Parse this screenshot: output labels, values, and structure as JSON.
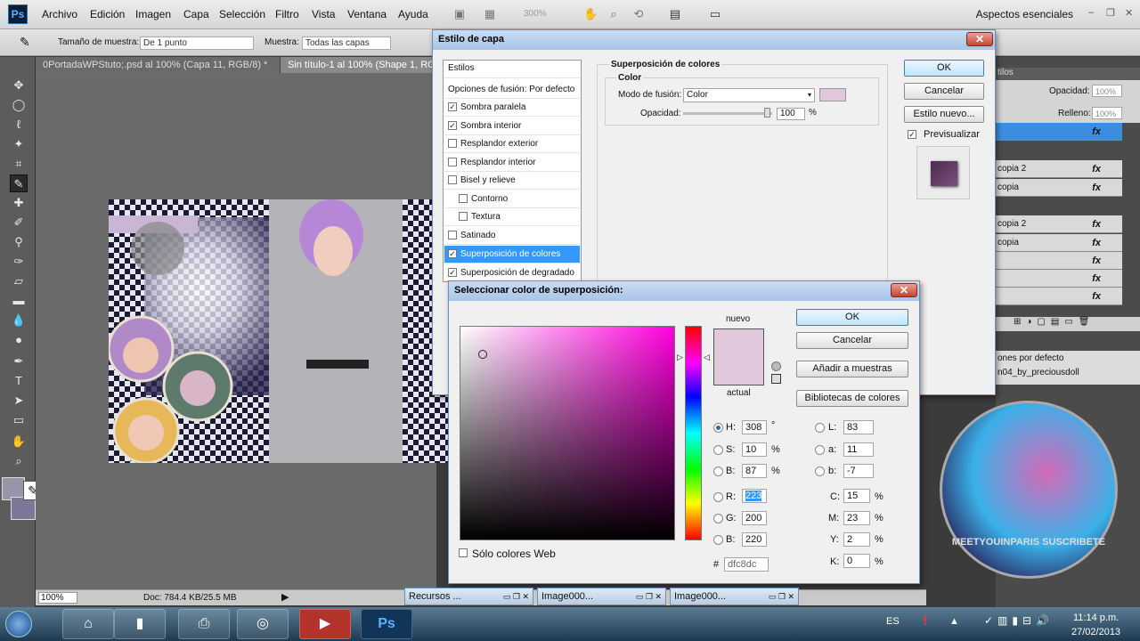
{
  "app": {
    "logo": "Ps",
    "accent": "#3399ff"
  },
  "menubar": {
    "items": [
      "Archivo",
      "Edición",
      "Imagen",
      "Capa",
      "Selección",
      "Filtro",
      "Vista",
      "Ventana",
      "Ayuda"
    ],
    "zoom": "300%",
    "workspace": "Aspectos esenciales",
    "window_controls": [
      "–",
      "❐",
      "✕"
    ]
  },
  "options": {
    "sample_size_label": "Tamaño de muestra:",
    "sample_size_value": "De 1 punto",
    "sample_label": "Muestra:",
    "sample_value": "Todas las capas"
  },
  "tabs": [
    {
      "label": "0PortadaWPStuto;.psd al 100% (Capa 11, RGB/8) *"
    },
    {
      "label": "Sin título-1 al 100% (Shape 1, RGB"
    }
  ],
  "status": {
    "zoom": "100%",
    "doc": "Doc: 784.4 KB/25.5 MB"
  },
  "layer_style": {
    "title": "Estilo de capa",
    "styles_header": "Estilos",
    "blend_options": "Opciones de fusión: Por defecto",
    "items": [
      {
        "label": "Sombra paralela",
        "checked": true
      },
      {
        "label": "Sombra interior",
        "checked": true
      },
      {
        "label": "Resplandor exterior",
        "checked": false
      },
      {
        "label": "Resplandor interior",
        "checked": false
      },
      {
        "label": "Bisel y relieve",
        "checked": false
      },
      {
        "label": "Contorno",
        "checked": false,
        "indent": true
      },
      {
        "label": "Textura",
        "checked": false,
        "indent": true
      },
      {
        "label": "Satinado",
        "checked": false
      },
      {
        "label": "Superposición de colores",
        "checked": true,
        "selected": true
      },
      {
        "label": "Superposición de degradado",
        "checked": true
      }
    ],
    "section_title": "Superposición de colores",
    "group_title": "Color",
    "blend_mode_label": "Modo de fusión:",
    "blend_mode_value": "Color",
    "opacity_label": "Opacidad:",
    "opacity_value": "100",
    "opacity_unit": "%",
    "ok": "OK",
    "cancel": "Cancelar",
    "new_style": "Estilo nuevo...",
    "preview": "Previsualizar",
    "swatch_color": "#dfc8dc"
  },
  "color_picker": {
    "title": "Seleccionar color de superposición:",
    "new_label": "nuevo",
    "current_label": "actual",
    "ok": "OK",
    "cancel": "Cancelar",
    "add_swatch": "Añadir a muestras",
    "libraries": "Bibliotecas de colores",
    "web_only": "Sólo colores Web",
    "hue_color": "#ff00dd",
    "fields": {
      "H": {
        "label": "H:",
        "value": "308",
        "unit": "°"
      },
      "S": {
        "label": "S:",
        "value": "10",
        "unit": "%"
      },
      "B": {
        "label": "B:",
        "value": "87",
        "unit": "%"
      },
      "R": {
        "label": "R:",
        "value": "223"
      },
      "G": {
        "label": "G:",
        "value": "200"
      },
      "Bb": {
        "label": "B:",
        "value": "220"
      },
      "L": {
        "label": "L:",
        "value": "83"
      },
      "a": {
        "label": "a:",
        "value": "11"
      },
      "b": {
        "label": "b:",
        "value": "-7"
      },
      "C": {
        "label": "C:",
        "value": "15",
        "unit": "%"
      },
      "M": {
        "label": "M:",
        "value": "23",
        "unit": "%"
      },
      "Y": {
        "label": "Y:",
        "value": "2",
        "unit": "%"
      },
      "K": {
        "label": "K:",
        "value": "0",
        "unit": "%"
      },
      "hex_label": "#",
      "hex": "dfc8dc"
    }
  },
  "layers_panel": {
    "opacity_label": "Opacidad:",
    "opacity_value": "100%",
    "fill_label": "Relleno:",
    "fill_value": "100%",
    "tab_label": "tilos",
    "rows": [
      {
        "label": "",
        "fx": "fx",
        "selected": true
      },
      {
        "label": "copia 2",
        "fx": "fx"
      },
      {
        "label": "copia",
        "fx": "fx"
      },
      {
        "label": "copia 2",
        "fx": "fx"
      },
      {
        "label": "copia",
        "fx": "fx"
      },
      {
        "label": "",
        "fx": "fx"
      },
      {
        "label": "",
        "fx": "fx"
      },
      {
        "label": "",
        "fx": "fx"
      }
    ],
    "styles_list": [
      "ones por defecto",
      "n04_by_preciousdoll"
    ]
  },
  "minimized": [
    {
      "label": "Recursos ..."
    },
    {
      "label": "Image000..."
    },
    {
      "label": "Image000..."
    }
  ],
  "taskbar": {
    "lang": "ES",
    "time": "11:14 p.m.",
    "date": "27/02/2013",
    "ps_label": "Ps"
  },
  "stamp_text": "MEETYOUINPARIS SUSCRIBETE"
}
